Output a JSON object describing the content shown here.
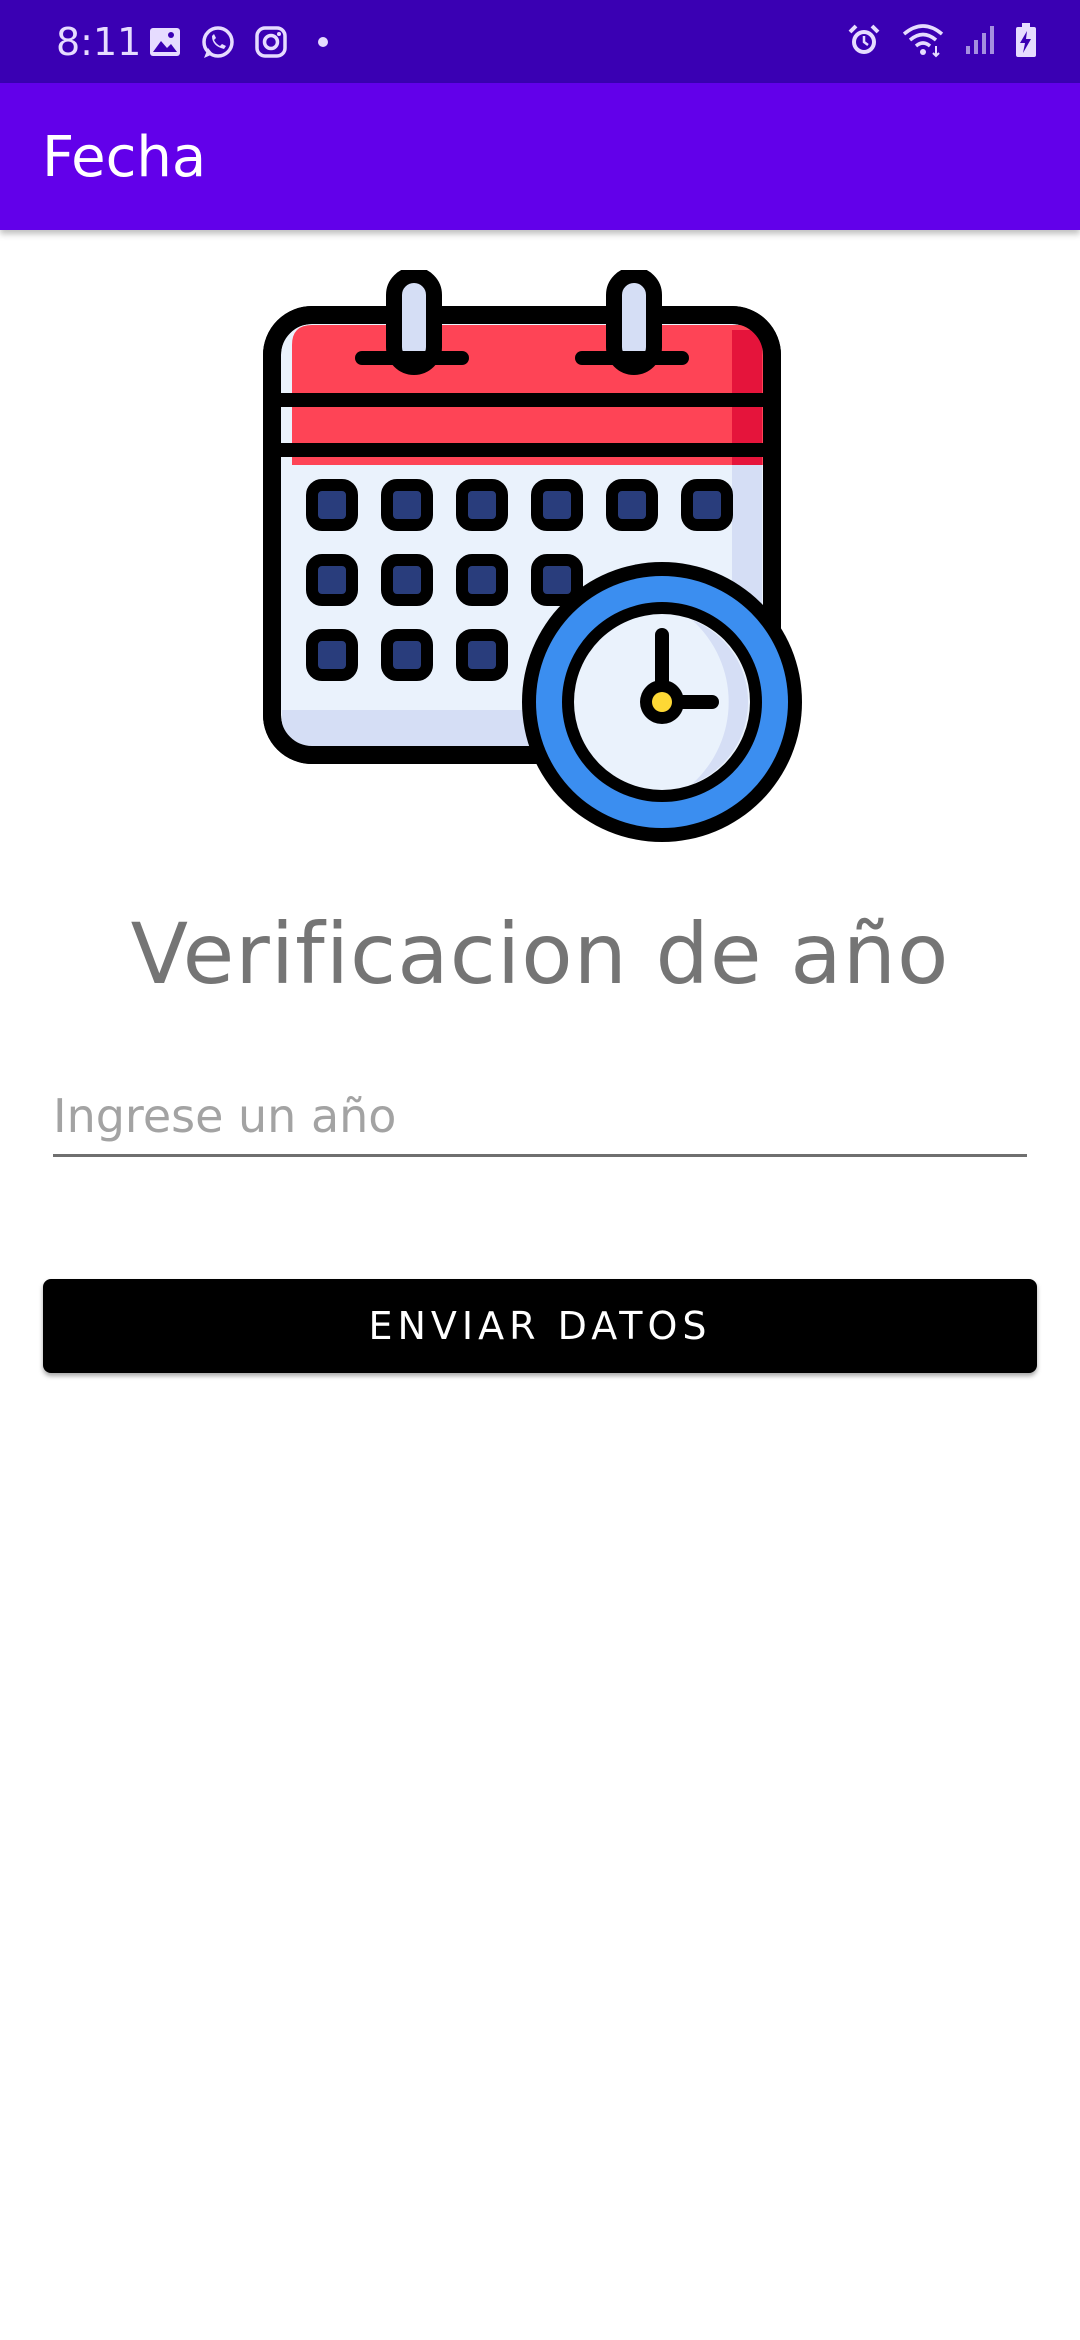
{
  "status_bar": {
    "time": "8:11",
    "left_icons": [
      "gallery-icon",
      "whatsapp-icon",
      "instagram-icon",
      "dot-icon"
    ],
    "right_icons": [
      "alarm-icon",
      "wifi-icon",
      "signal-icon",
      "battery-icon"
    ],
    "background_color": "#3a00b3"
  },
  "app_bar": {
    "title": "Fecha",
    "background_color": "#6200ea"
  },
  "illustration": {
    "icon": "calendar-clock-icon"
  },
  "main": {
    "heading": "Verificacion de año",
    "year_input": {
      "value": "",
      "placeholder": "Ingrese un año"
    },
    "submit_button_label": "ENVIAR DATOS"
  }
}
